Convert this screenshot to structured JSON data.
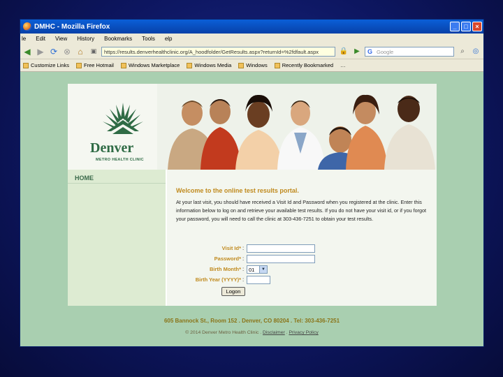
{
  "window": {
    "title": "DMHC - Mozilla Firefox",
    "controls": {
      "minimize": "_",
      "maximize": "□",
      "close": "×"
    }
  },
  "menu": [
    "le",
    "Edit",
    "View",
    "History",
    "Bookmarks",
    "Tools",
    "elp"
  ],
  "nav": {
    "url": "https://results.denverhealthclinic.org/A_hoodfolder/GetResults.aspx?returnId=%2fdfault.aspx",
    "search_placeholder": "Google",
    "search_engine_letter": "G"
  },
  "bookmarks": [
    "Customize Links",
    "Free Hotmail",
    "Windows Marketplace",
    "Windows Media",
    "Windows",
    "Recently Bookmarked",
    "…"
  ],
  "site": {
    "logo_name": "Denver",
    "logo_sub": "METRO HEALTH CLINIC",
    "sidebar_home": "HOME",
    "welcome": "Welcome to the online test results portal.",
    "intro": "At your last visit, you should have received a Visit Id and Password when you registered at the clinic. Enter this information below to log on and retrieve your available test results. If you do not have your visit id, or if you forgot your password, you will need to call the clinic at 303-436-7251 to obtain your test results.",
    "form": {
      "visit_id_label": "Visit Id*",
      "password_label": "Password*",
      "birth_month_label": "Birth Month*",
      "birth_month_value": "01",
      "birth_year_label": "Birth Year (YYYY)*",
      "login_button": "Logon"
    },
    "footer_address": "605 Bannock St., Room 152 . Denver, CO 80204 . Tel: 303-436-7251",
    "footer_copyright": "© 2014 Denver Metro Health Clinic .",
    "footer_disclaimer": "Disclaimer",
    "footer_privacy": "Privacy Policy"
  },
  "colors": {
    "brand_green": "#2f6b45",
    "label_gold": "#c08a1e",
    "page_background": "#a9cfb0"
  }
}
